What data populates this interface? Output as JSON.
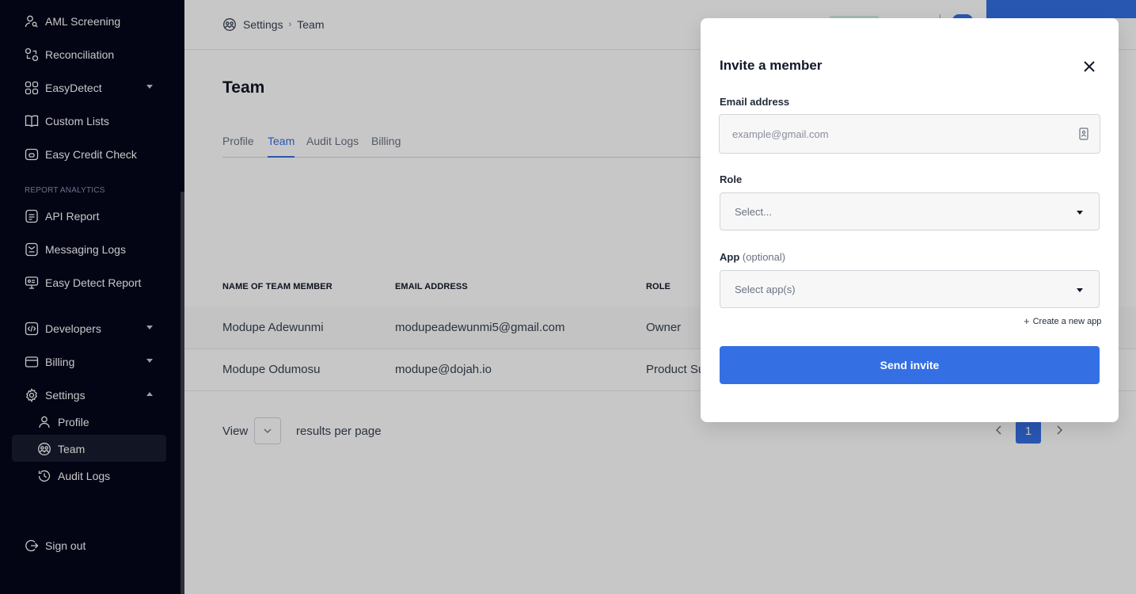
{
  "sidebar": {
    "items": [
      {
        "label": "AML Screening",
        "icon": "user-search-icon"
      },
      {
        "label": "Reconciliation",
        "icon": "reconciliation-icon"
      },
      {
        "label": "EasyDetect",
        "icon": "grid-icon"
      },
      {
        "label": "Custom Lists",
        "icon": "book-icon"
      },
      {
        "label": "Easy Credit Check",
        "icon": "wallet-icon"
      }
    ],
    "section_label": "REPORT ANALYTICS",
    "report_items": [
      {
        "label": "API Report",
        "icon": "document-icon"
      },
      {
        "label": "Messaging Logs",
        "icon": "message-icon"
      },
      {
        "label": "Easy Detect Report",
        "icon": "monitor-icon"
      }
    ],
    "bottom_items": [
      {
        "label": "Developers",
        "icon": "code-icon"
      },
      {
        "label": "Billing",
        "icon": "card-icon"
      },
      {
        "label": "Settings",
        "icon": "gear-icon"
      }
    ],
    "settings_sub": [
      {
        "label": "Profile"
      },
      {
        "label": "Team"
      },
      {
        "label": "Audit Logs"
      }
    ],
    "sign_out": "Sign out"
  },
  "header": {
    "breadcrumb_root": "Settings",
    "breadcrumb_current": "Team"
  },
  "page": {
    "title": "Team",
    "tabs": [
      "Profile",
      "Team",
      "Audit Logs",
      "Billing"
    ],
    "active_tab": "Team"
  },
  "table": {
    "columns": [
      "NAME OF TEAM MEMBER",
      "EMAIL ADDRESS",
      "ROLE"
    ],
    "rows": [
      {
        "name": "Modupe Adewunmi",
        "email": "modupeadewunmi5@gmail.com",
        "role": "Owner"
      },
      {
        "name": "Modupe Odumosu",
        "email": "modupe@dojah.io",
        "role": "Product Su"
      }
    ]
  },
  "pagination": {
    "view_label": "View",
    "rpp_label": "results per page",
    "current_page": "1"
  },
  "modal": {
    "title": "Invite a member",
    "email_label": "Email address",
    "email_placeholder": "example@gmail.com",
    "role_label": "Role",
    "role_value": "Select...",
    "app_label": "App",
    "app_optional": "(optional)",
    "app_value": "Select app(s)",
    "create_app": "Create a new app",
    "send_button": "Send invite"
  },
  "colors": {
    "sidebar_bg": "#04061a",
    "accent": "#3470e4"
  }
}
